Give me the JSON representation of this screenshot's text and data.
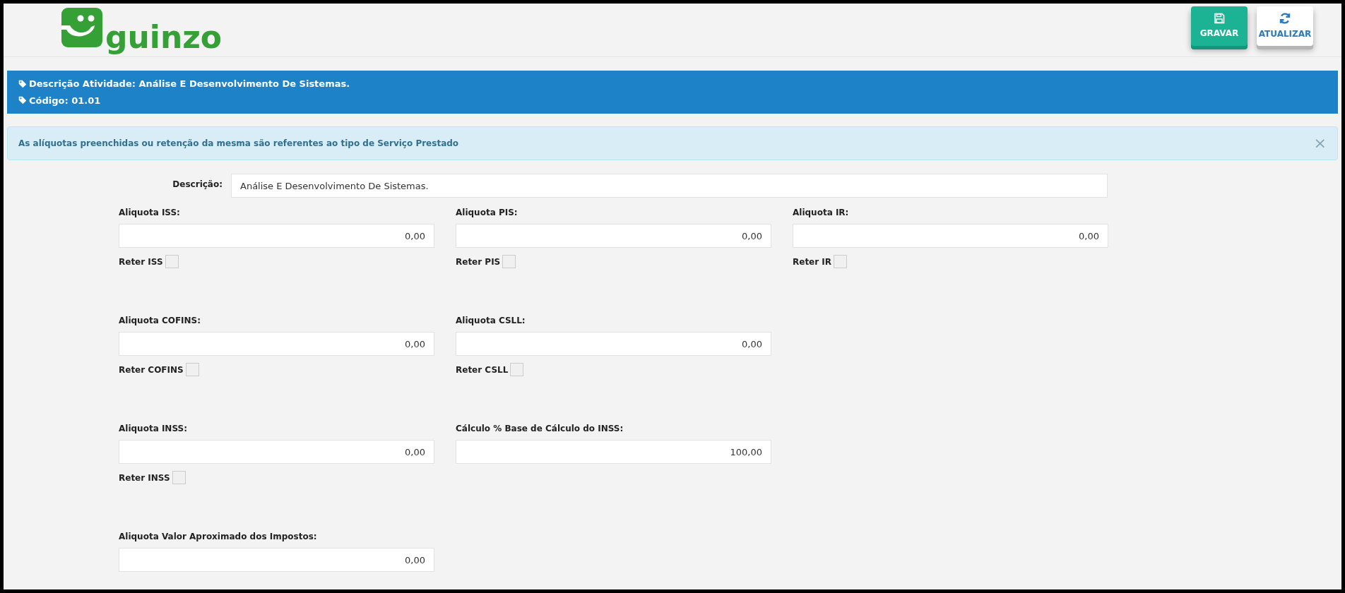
{
  "logo": {
    "text": "guinzo"
  },
  "toolbar": [
    {
      "kind": "save",
      "label": "GRAVAR"
    },
    {
      "kind": "refresh",
      "label": "ATUALIZAR"
    }
  ],
  "banner": [
    "Descrição Atividade: Análise E Desenvolvimento De Sistemas.",
    "Código: 01.01"
  ],
  "alert": {
    "text": "As alíquotas preenchidas ou retenção da mesma são referentes ao tipo de Serviço Prestado",
    "close": "×"
  },
  "description": {
    "label": "Descrição:",
    "value": "Análise E Desenvolvimento De Sistemas."
  },
  "rows": [
    [
      {
        "label": "Aliquota ISS:",
        "value": "0,00",
        "retain": {
          "label": "Reter ISS",
          "checked": false
        }
      },
      {
        "label": "Aliquota PIS:",
        "value": "0,00",
        "retain": {
          "label": "Reter PIS",
          "checked": false
        }
      },
      {
        "label": "Aliquota IR:",
        "value": "0,00",
        "retain": {
          "label": "Reter IR",
          "checked": false
        }
      }
    ],
    [
      {
        "label": "Aliquota COFINS:",
        "value": "0,00",
        "retain": {
          "label": "Reter COFINS",
          "checked": false
        }
      },
      {
        "label": "Aliquota CSLL:",
        "value": "0,00",
        "retain": {
          "label": "Reter CSLL",
          "checked": false
        }
      }
    ],
    [
      {
        "label": "Aliquota INSS:",
        "value": "0,00",
        "retain": {
          "label": "Reter INSS",
          "checked": false
        }
      },
      {
        "label": "Cálculo % Base de Cálculo do INSS:",
        "value": "100,00"
      }
    ],
    [
      {
        "label": "Aliquota Valor Aproximado dos Impostos:",
        "value": "0,00"
      }
    ]
  ]
}
